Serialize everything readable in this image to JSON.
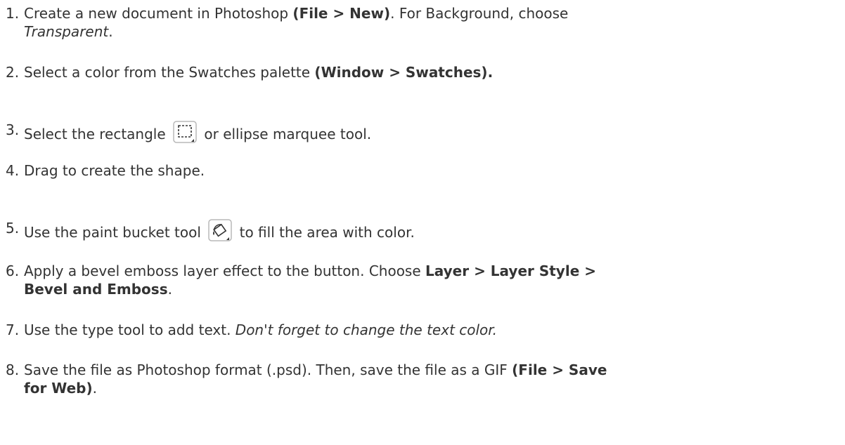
{
  "steps": [
    {
      "num": "1.",
      "a": "Create a new document in Photoshop ",
      "b": "(File > New)",
      "c": ".  For Background, choose",
      "d": "Transparent",
      "e": "."
    },
    {
      "num": "2.",
      "a": "Select a color from the Swatches palette ",
      "b": "(Window > Swatches)."
    },
    {
      "num": "3.",
      "a": "Select the rectangle",
      "icon": "rectangle-marquee-icon",
      "b": "or ellipse marquee tool."
    },
    {
      "num": "4.",
      "a": "Drag to create the shape."
    },
    {
      "num": "5.",
      "a": "Use the paint bucket tool",
      "icon": "paint-bucket-icon",
      "b": "to fill the area with color."
    },
    {
      "num": "6.",
      "a": "Apply a bevel emboss layer effect to the button.  Choose ",
      "b": "Layer > Layer Style >",
      "c": "Bevel and Emboss",
      "d": "."
    },
    {
      "num": "7.",
      "a": "Use the type tool to add text.  ",
      "b": "Don't forget to change the text color."
    },
    {
      "num": "8.",
      "a": "Save the file as Photoshop format (.psd).  Then, save the file as a GIF ",
      "b": "(File > Save",
      "c": "for Web)",
      "d": "."
    }
  ]
}
